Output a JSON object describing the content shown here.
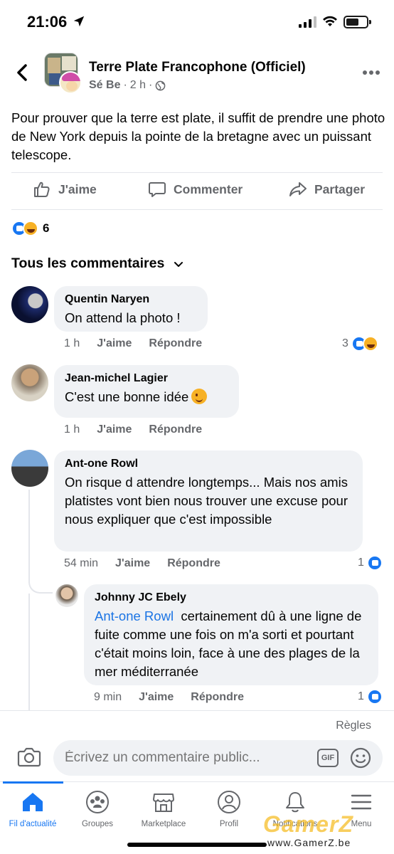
{
  "status_bar": {
    "time": "21:06"
  },
  "header": {
    "group_name": "Terre Plate Francophone (Officiel)",
    "author": "Sé Be",
    "time": "2 h"
  },
  "post": {
    "text": "Pour prouver que la terre est plate, il suffit de prendre une photo de New York depuis la pointe de la bretagne avec un puissant telescope."
  },
  "actions": {
    "like": "J'aime",
    "comment": "Commenter",
    "share": "Partager"
  },
  "reactions": {
    "count": "6"
  },
  "comments_header": "Tous les commentaires",
  "comments": [
    {
      "author": "Quentin Naryen",
      "text": "On attend la photo !",
      "time": "1 h",
      "like": "J'aime",
      "reply": "Répondre",
      "reactions": "3"
    },
    {
      "author": "Jean-michel Lagier",
      "text": "C'est une bonne idée",
      "time": "1 h",
      "like": "J'aime",
      "reply": "Répondre"
    },
    {
      "author": "Ant-one Rowl",
      "text": "On risque d attendre longtemps... Mais nos amis platistes vont bien nous trouver une excuse pour nous expliquer que c'est impossible",
      "time": "54 min",
      "like": "J'aime",
      "reply": "Répondre",
      "reactions": "1"
    },
    {
      "author": "Johnny JC Ebely",
      "mention": "Ant-one Rowl",
      "text": "certainement dû à une ligne de fuite comme une fois on m'a sorti et pourtant c'était moins loin, face à une des plages de la mer méditerranée",
      "time": "9 min",
      "like": "J'aime",
      "reply": "Répondre",
      "reactions": "1"
    }
  ],
  "composer": {
    "rules": "Règles",
    "placeholder": "Écrivez un commentaire public...",
    "gif": "GIF"
  },
  "tabs": [
    {
      "label": "Fil d'actualité",
      "icon": "home-icon"
    },
    {
      "label": "Groupes",
      "icon": "groups-icon"
    },
    {
      "label": "Marketplace",
      "icon": "marketplace-icon"
    },
    {
      "label": "Profil",
      "icon": "profile-icon"
    },
    {
      "label": "Notifications",
      "icon": "bell-icon"
    },
    {
      "label": "Menu",
      "icon": "menu-icon"
    }
  ],
  "watermark": {
    "logo": "GamerZ",
    "url": "www.GamerZ.be"
  },
  "colors": {
    "accent": "#1877f2",
    "text": "#050505",
    "secondary": "#65676b",
    "bubble": "#f0f2f5",
    "mention": "#1b74e4"
  }
}
